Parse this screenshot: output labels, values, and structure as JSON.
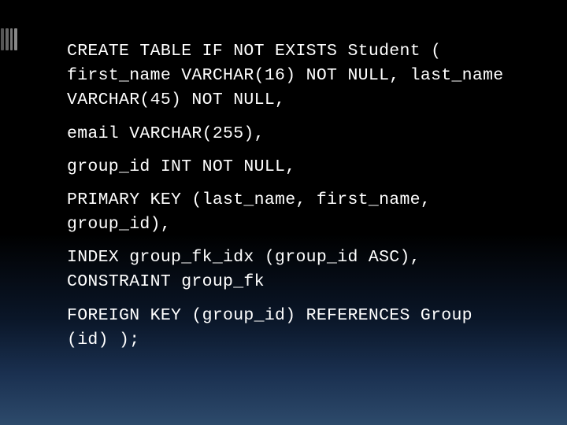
{
  "slide": {
    "lines": [
      "CREATE TABLE IF NOT EXISTS Student ( first_name VARCHAR(16) NOT NULL, last_name VARCHAR(45) NOT NULL,",
      "email VARCHAR(255),",
      "group_id INT NOT NULL,",
      "PRIMARY KEY (last_name, first_name, group_id),",
      "INDEX group_fk_idx (group_id ASC), CONSTRAINT group_fk",
      "FOREIGN KEY (group_id) REFERENCES Group (id) );"
    ]
  }
}
